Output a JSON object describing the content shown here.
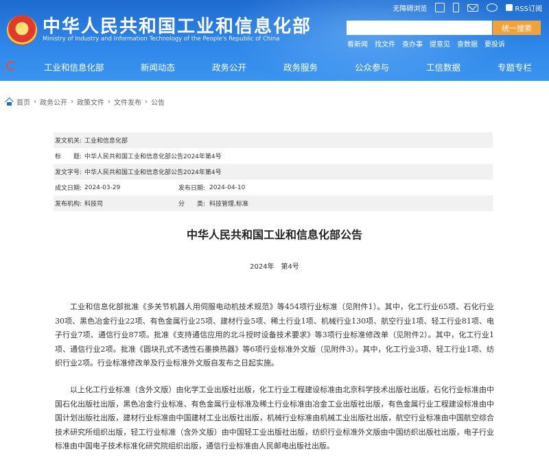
{
  "header": {
    "title": "中华人民共和国工业和信息化部",
    "subtitle": "Ministry of Industry and Information Technology of the People's Republic of China",
    "top_links": {
      "barrier_free": "无障碍浏览",
      "rss": "RSS订阅"
    },
    "search": {
      "placeholder": "",
      "button": "统一搜索"
    },
    "quick_links": [
      "看新闻",
      "找文件",
      "查办事",
      "提意见",
      "查数据",
      "要投诉"
    ]
  },
  "nav": {
    "items": [
      "工业和信息化部",
      "新闻动态",
      "政务公开",
      "政务服务",
      "公众参与",
      "工信数据",
      "专题专栏"
    ]
  },
  "breadcrumb": [
    "首页",
    "政务公开",
    "政策文件",
    "文件发布",
    "公告"
  ],
  "meta": {
    "issuer_label": "发文机关:",
    "issuer": "工业和信息化部",
    "title_label": "标　　题:",
    "title": "中华人民共和国工业和信息化部公告2024年第4号",
    "doc_no_label": "发文字号:",
    "doc_no": "中华人民共和国工业和信息化部公告2024年第4号",
    "created_label": "成文日期:",
    "created": "2024-03-29",
    "published_label": "发布日期:",
    "published": "2024-04-10",
    "org_label": "发布机构:",
    "org": "科技司",
    "category_label": "分　　类:",
    "category": "科技管理,标准"
  },
  "document": {
    "title": "中华人民共和国工业和信息化部公告",
    "number": "2024年　第4号",
    "paragraphs": [
      "工业和信息化部批准《多关节机器人用伺服电动机技术规范》等454项行业标准（见附件1）。其中，化工行业65项、石化行业30项、黑色冶金行业22项、有色金属行业25项、建材行业5项、稀土行业1项、机械行业130项、航空行业1项、轻工行业81项、电子行业7项、通信行业87项。批准《支持通信应用的北斗授时设备技术要求》等3项行业标准修改单（见附件2）。其中，化工行业1项、通信行业2项。批准《圆块孔式不透性石墨换热器》等6项行业标准外文版（见附件3）。其中，化工行业3项、轻工行业1项、纺织行业2项。行业标准修改单及行业标准外文版自发布之日起实施。",
      "以上化工行业标准（含外文版）由化学工业出版社出版，化工行业工程建设标准由北京科学技术出版社出版，石化行业标准由中国石化出版社出版，黑色冶金行业标准、有色金属行业标准及稀土行业标准由冶金工业出版社出版，有色金属行业工程建设标准由中国计划出版社出版，建材行业标准由中国建材工业出版社出版，机械行业标准由机械工业出版社出版，航空行业标准由中国航空综合技术研究所组织出版，轻工行业标准（含外文版）由中国轻工业出版社出版，纺织行业标准外文版由中国纺织出版社出版，电子行业标准由中国电子技术标准化研究院组织出版，通信行业标准由人民邮电出版社出版。"
    ]
  },
  "colors": {
    "header_blue": "#1f6bd0",
    "search_orange": "#f3a13a",
    "meta_shade": "#f1f1f1"
  }
}
